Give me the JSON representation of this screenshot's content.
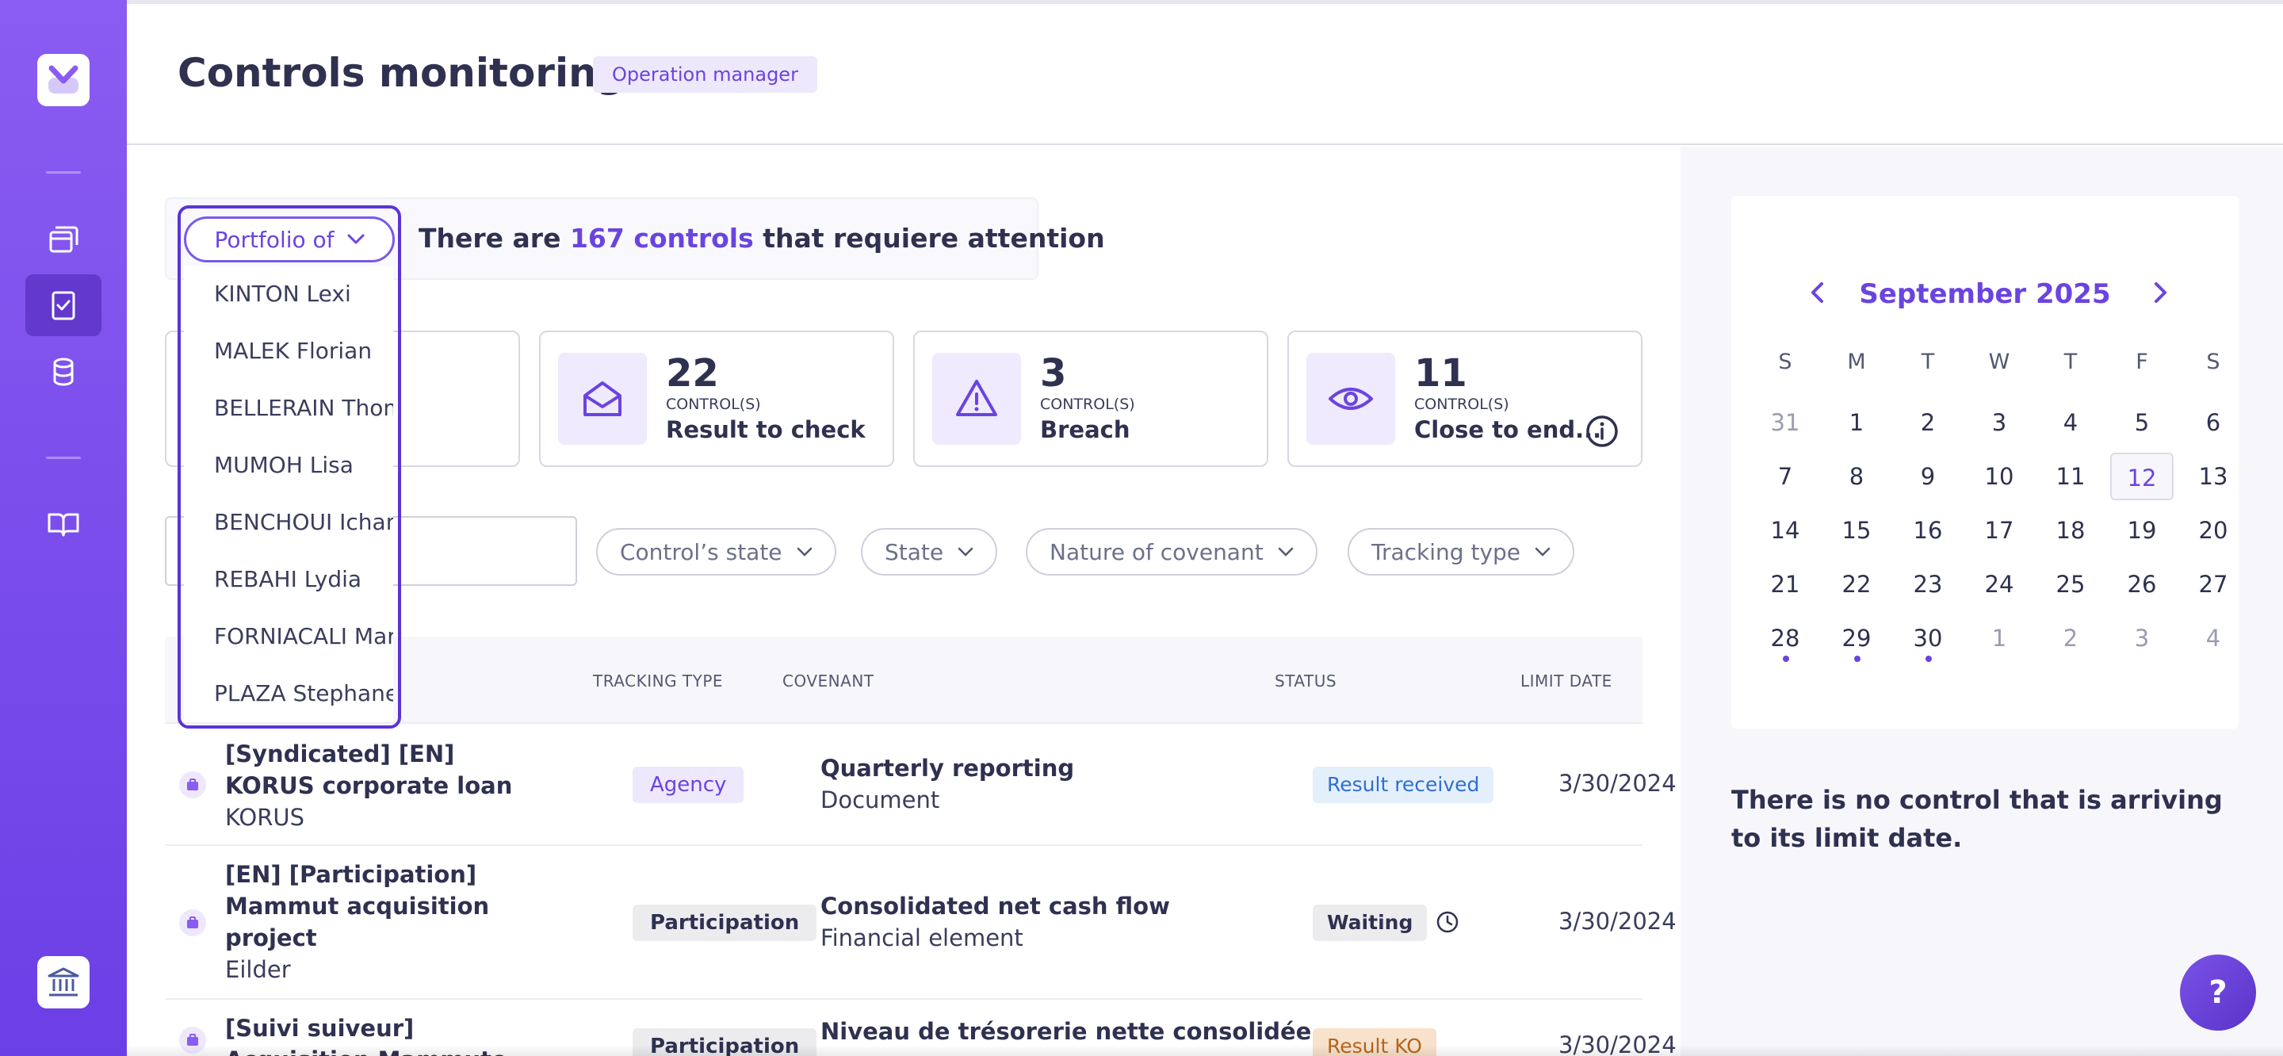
{
  "header": {
    "title": "Controls monitoring",
    "role": "Operation manager"
  },
  "sidebar": {
    "items": [
      "logo-icon",
      "portfolio-icon",
      "controls-icon",
      "database-icon",
      "book-icon",
      "bank-icon"
    ]
  },
  "attention": {
    "portfolio_label": "Portfolio of",
    "text_before": "There are ",
    "count_text": "167 controls",
    "text_after": " that requiere attention"
  },
  "portfolio_options": [
    "KINTON Lexi",
    "MALEK Florian",
    "BELLERAIN Thomas",
    "MUMOH Lisa",
    "BENCHOUI Icham",
    "REBAHI Lydia",
    "FORNIACALI Marie",
    "PLAZA Stephane"
  ],
  "stats": [
    {
      "value": "22",
      "unit": "CONTROL(S)",
      "label": "Result to check",
      "icon": "envelope-open-icon"
    },
    {
      "value": "3",
      "unit": "CONTROL(S)",
      "label": "Breach",
      "icon": "warning-icon"
    },
    {
      "value": "11",
      "unit": "CONTROL(S)",
      "label": "Close to end...",
      "icon": "eye-icon"
    }
  ],
  "filters": [
    "Control’s state",
    "State",
    "Nature of covenant",
    "Tracking type"
  ],
  "table": {
    "headers": {
      "tracking": "TRACKING TYPE",
      "covenant": "COVENANT",
      "status": "STATUS",
      "limit": "LIMIT DATE"
    },
    "rows": [
      {
        "name": "[Syndicated] [EN] KORUS corporate loan",
        "sub": "KORUS",
        "tracking": "Agency",
        "covenant": "Quarterly reporting",
        "covenant_sub": "Document",
        "status": "Result received",
        "limit": "3/30/2024"
      },
      {
        "name": "[EN] [Participation] Mammut acquisition project",
        "sub": "Eilder",
        "tracking": "Participation",
        "covenant": "Consolidated net cash flow",
        "covenant_sub": "Financial element",
        "status": "Waiting",
        "limit": "3/30/2024"
      },
      {
        "name": "[Suivi suiveur] Acquisition Mammuto",
        "sub": "",
        "tracking": "Participation",
        "covenant": "Niveau de trésorerie nette consolidée",
        "covenant_sub": "",
        "status": "Result KO",
        "limit": "3/30/2024"
      }
    ]
  },
  "calendar": {
    "month": "September 2025",
    "dow": [
      "S",
      "M",
      "T",
      "W",
      "T",
      "F",
      "S"
    ],
    "weeks": [
      [
        "31",
        "1",
        "2",
        "3",
        "4",
        "5",
        "6"
      ],
      [
        "7",
        "8",
        "9",
        "10",
        "11",
        "12",
        "13"
      ],
      [
        "14",
        "15",
        "16",
        "17",
        "18",
        "19",
        "20"
      ],
      [
        "21",
        "22",
        "23",
        "24",
        "25",
        "26",
        "27"
      ],
      [
        "28",
        "29",
        "30",
        "1",
        "2",
        "3",
        "4"
      ]
    ],
    "today": "12"
  },
  "no_control_text": "There is no control that is arriving to its limit date.",
  "help_label": "?",
  "colors": {
    "accent": "#6a44e0",
    "sidebar": "#7a4fee"
  }
}
